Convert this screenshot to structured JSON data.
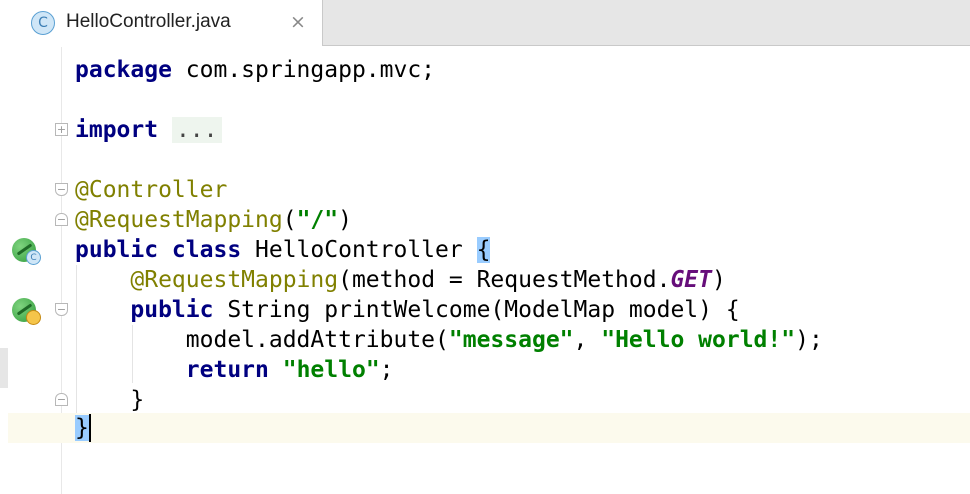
{
  "tab": {
    "icon_letter": "C",
    "title": "HelloController.java",
    "close_glyph": "×"
  },
  "gutter": {
    "fold_expand_glyph": "+",
    "fold_collapse_glyph": "−",
    "bean_badge_class": "C"
  },
  "code": {
    "l1_kw": "package",
    "l1_rest": " com.springapp.mvc;",
    "l2_kw": "import",
    "l2_fold": "...",
    "l3_ann": "@Controller",
    "l4_ann": "@RequestMapping",
    "l4_open": "(",
    "l4_str": "\"/\"",
    "l4_close": ")",
    "l5_kw": "public class",
    "l5_name": " HelloController ",
    "l5_brace": "{",
    "l6_ann": "@RequestMapping",
    "l6_rest": "(method = RequestMethod.",
    "l6_const": "GET",
    "l6_close": ")",
    "l7_kw": "public",
    "l7_rest": " String printWelcome(ModelMap model) {",
    "l8_a": "model.addAttribute(",
    "l8_s1": "\"message\"",
    "l8_b": ", ",
    "l8_s2": "\"Hello world!\"",
    "l8_c": ");",
    "l9_kw": "return",
    "l9_sp": " ",
    "l9_str": "\"hello\"",
    "l9_end": ";",
    "l10": "}",
    "l11": "}"
  },
  "colors": {
    "keyword": "#000080",
    "annotation": "#808000",
    "string": "#008000",
    "constant": "#660e7a",
    "brace_match": "#99ccff",
    "current_line": "#fcfaed"
  }
}
